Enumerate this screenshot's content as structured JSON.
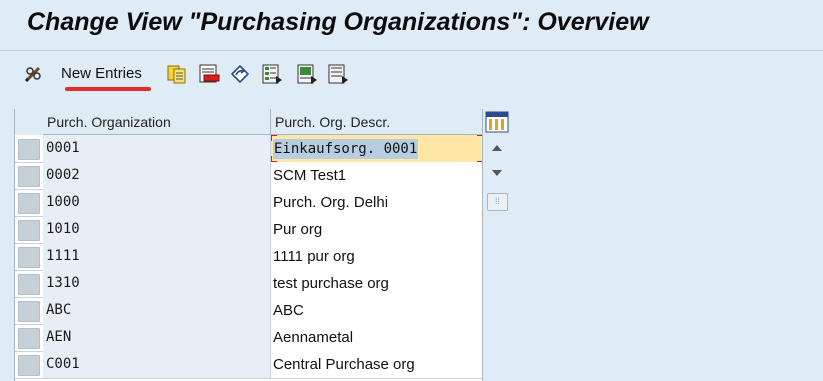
{
  "window": {
    "title": "Change View \"Purchasing Organizations\": Overview"
  },
  "toolbar": {
    "new_entries_label": "New Entries",
    "icons": [
      "display-change-icon",
      "copy-as-icon",
      "delete-icon",
      "undo-change-icon",
      "select-all-icon",
      "select-block-icon",
      "deselect-all-icon"
    ]
  },
  "table": {
    "headers": [
      "Purch. Organization",
      "Purch. Org. Descr."
    ],
    "rows": [
      {
        "code": "0001",
        "desc": "Einkaufsorg. 0001"
      },
      {
        "code": "0002",
        "desc": "SCM Test1"
      },
      {
        "code": "1000",
        "desc": "Purch. Org. Delhi"
      },
      {
        "code": "1010",
        "desc": "Pur org"
      },
      {
        "code": "1111",
        "desc": "1111 pur org"
      },
      {
        "code": "1310",
        "desc": "test purchase org"
      },
      {
        "code": "ABC",
        "desc": "ABC"
      },
      {
        "code": "AEN",
        "desc": "Aennametal"
      },
      {
        "code": "C001",
        "desc": "Central Purchase org"
      }
    ],
    "active_row": 0
  },
  "colors": {
    "background": "#dfebf5",
    "key_column": "#e7eef6",
    "active_cell": "#ffe8a6",
    "selection": "#b8cde2",
    "annotation_red": "#e12d2d"
  }
}
